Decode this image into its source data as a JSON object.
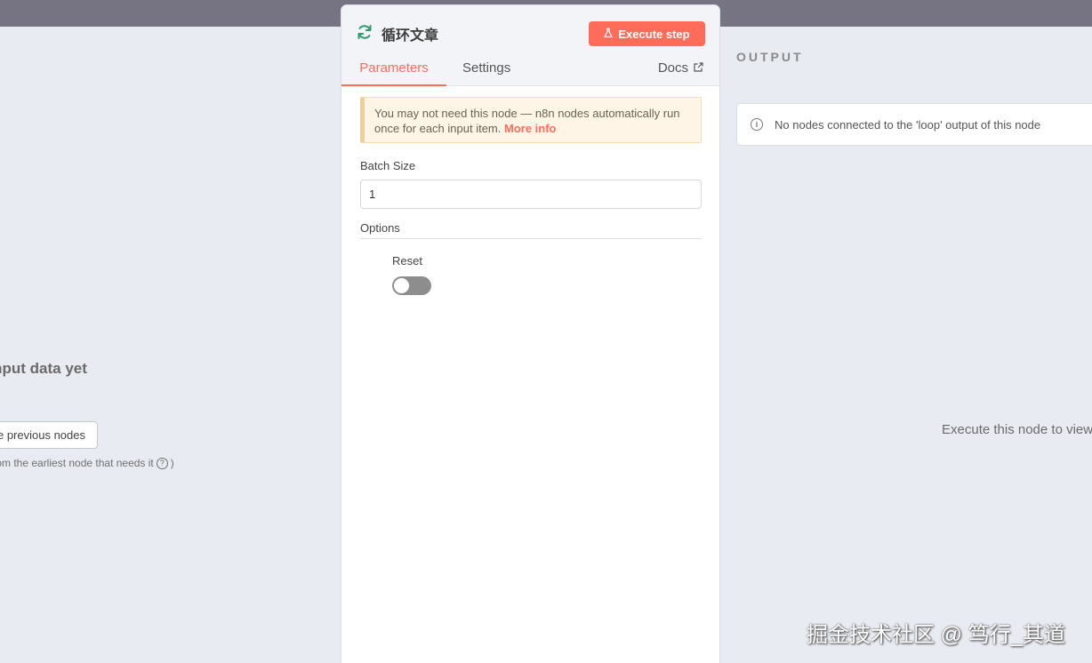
{
  "input": {
    "empty_title": "No input data yet",
    "execute_previous_label": "Execute previous nodes",
    "hint": "(From the earliest node that needs it",
    "hint_close": ")"
  },
  "node": {
    "title": "循环文章",
    "execute_label": "Execute step",
    "icon": "refresh-icon",
    "accent_color": "#ff6d5a"
  },
  "tabs": [
    {
      "label": "Parameters",
      "active": true
    },
    {
      "label": "Settings",
      "active": false
    }
  ],
  "docs_label": "Docs",
  "notice": {
    "text": "You may not need this node — n8n nodes automatically run once for each input item.",
    "link": "More info"
  },
  "batch_size": {
    "label": "Batch Size",
    "value": "1"
  },
  "options": {
    "label": "Options",
    "reset_label": "Reset",
    "reset_on": false
  },
  "output": {
    "title": "OUTPUT",
    "message": "No nodes connected to the 'loop' output of this node",
    "execute_hint": "Execute this node to view data"
  },
  "watermark": "掘金技术社区 @ 笃行_其道"
}
